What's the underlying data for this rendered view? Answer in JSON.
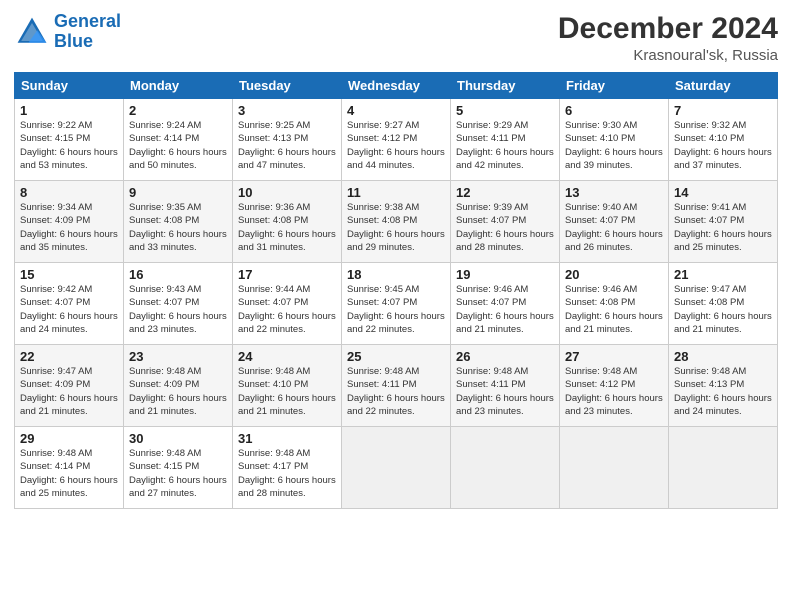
{
  "header": {
    "logo_line1": "General",
    "logo_line2": "Blue",
    "month": "December 2024",
    "location": "Krasnoural'sk, Russia"
  },
  "weekdays": [
    "Sunday",
    "Monday",
    "Tuesday",
    "Wednesday",
    "Thursday",
    "Friday",
    "Saturday"
  ],
  "weeks": [
    [
      {
        "day": "1",
        "sunrise": "9:22 AM",
        "sunset": "4:15 PM",
        "daylight": "6 hours and 53 minutes."
      },
      {
        "day": "2",
        "sunrise": "9:24 AM",
        "sunset": "4:14 PM",
        "daylight": "6 hours and 50 minutes."
      },
      {
        "day": "3",
        "sunrise": "9:25 AM",
        "sunset": "4:13 PM",
        "daylight": "6 hours and 47 minutes."
      },
      {
        "day": "4",
        "sunrise": "9:27 AM",
        "sunset": "4:12 PM",
        "daylight": "6 hours and 44 minutes."
      },
      {
        "day": "5",
        "sunrise": "9:29 AM",
        "sunset": "4:11 PM",
        "daylight": "6 hours and 42 minutes."
      },
      {
        "day": "6",
        "sunrise": "9:30 AM",
        "sunset": "4:10 PM",
        "daylight": "6 hours and 39 minutes."
      },
      {
        "day": "7",
        "sunrise": "9:32 AM",
        "sunset": "4:10 PM",
        "daylight": "6 hours and 37 minutes."
      }
    ],
    [
      {
        "day": "8",
        "sunrise": "9:34 AM",
        "sunset": "4:09 PM",
        "daylight": "6 hours and 35 minutes."
      },
      {
        "day": "9",
        "sunrise": "9:35 AM",
        "sunset": "4:08 PM",
        "daylight": "6 hours and 33 minutes."
      },
      {
        "day": "10",
        "sunrise": "9:36 AM",
        "sunset": "4:08 PM",
        "daylight": "6 hours and 31 minutes."
      },
      {
        "day": "11",
        "sunrise": "9:38 AM",
        "sunset": "4:08 PM",
        "daylight": "6 hours and 29 minutes."
      },
      {
        "day": "12",
        "sunrise": "9:39 AM",
        "sunset": "4:07 PM",
        "daylight": "6 hours and 28 minutes."
      },
      {
        "day": "13",
        "sunrise": "9:40 AM",
        "sunset": "4:07 PM",
        "daylight": "6 hours and 26 minutes."
      },
      {
        "day": "14",
        "sunrise": "9:41 AM",
        "sunset": "4:07 PM",
        "daylight": "6 hours and 25 minutes."
      }
    ],
    [
      {
        "day": "15",
        "sunrise": "9:42 AM",
        "sunset": "4:07 PM",
        "daylight": "6 hours and 24 minutes."
      },
      {
        "day": "16",
        "sunrise": "9:43 AM",
        "sunset": "4:07 PM",
        "daylight": "6 hours and 23 minutes."
      },
      {
        "day": "17",
        "sunrise": "9:44 AM",
        "sunset": "4:07 PM",
        "daylight": "6 hours and 22 minutes."
      },
      {
        "day": "18",
        "sunrise": "9:45 AM",
        "sunset": "4:07 PM",
        "daylight": "6 hours and 22 minutes."
      },
      {
        "day": "19",
        "sunrise": "9:46 AM",
        "sunset": "4:07 PM",
        "daylight": "6 hours and 21 minutes."
      },
      {
        "day": "20",
        "sunrise": "9:46 AM",
        "sunset": "4:08 PM",
        "daylight": "6 hours and 21 minutes."
      },
      {
        "day": "21",
        "sunrise": "9:47 AM",
        "sunset": "4:08 PM",
        "daylight": "6 hours and 21 minutes."
      }
    ],
    [
      {
        "day": "22",
        "sunrise": "9:47 AM",
        "sunset": "4:09 PM",
        "daylight": "6 hours and 21 minutes."
      },
      {
        "day": "23",
        "sunrise": "9:48 AM",
        "sunset": "4:09 PM",
        "daylight": "6 hours and 21 minutes."
      },
      {
        "day": "24",
        "sunrise": "9:48 AM",
        "sunset": "4:10 PM",
        "daylight": "6 hours and 21 minutes."
      },
      {
        "day": "25",
        "sunrise": "9:48 AM",
        "sunset": "4:11 PM",
        "daylight": "6 hours and 22 minutes."
      },
      {
        "day": "26",
        "sunrise": "9:48 AM",
        "sunset": "4:11 PM",
        "daylight": "6 hours and 23 minutes."
      },
      {
        "day": "27",
        "sunrise": "9:48 AM",
        "sunset": "4:12 PM",
        "daylight": "6 hours and 23 minutes."
      },
      {
        "day": "28",
        "sunrise": "9:48 AM",
        "sunset": "4:13 PM",
        "daylight": "6 hours and 24 minutes."
      }
    ],
    [
      {
        "day": "29",
        "sunrise": "9:48 AM",
        "sunset": "4:14 PM",
        "daylight": "6 hours and 25 minutes."
      },
      {
        "day": "30",
        "sunrise": "9:48 AM",
        "sunset": "4:15 PM",
        "daylight": "6 hours and 27 minutes."
      },
      {
        "day": "31",
        "sunrise": "9:48 AM",
        "sunset": "4:17 PM",
        "daylight": "6 hours and 28 minutes."
      },
      null,
      null,
      null,
      null
    ]
  ]
}
